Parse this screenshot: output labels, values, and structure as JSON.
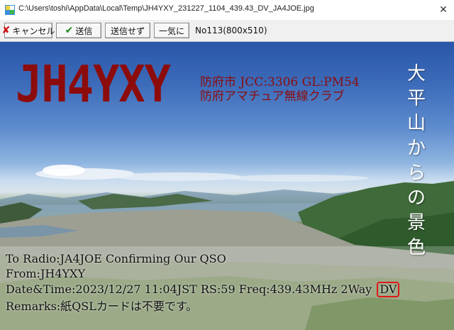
{
  "window": {
    "title": "C:\\Users\\toshi\\AppData\\Local\\Temp\\JH4YXY_231227_1104_439.43_DV_JA4JOE.jpg",
    "close_glyph": "✕"
  },
  "toolbar": {
    "cancel_label": "キャンセル",
    "send_label": "送信",
    "no_send_label": "送信せず",
    "all_at_once_label": "一気に",
    "counter_text": "No113(800x510)"
  },
  "card": {
    "callsign": "JH4YXY",
    "info_line1": "防府市 JCC:3306 GL:PM54",
    "info_line2": "防府アマチュア無線クラブ",
    "vertical_text": [
      "大",
      "平",
      "山",
      "か",
      "ら",
      "の",
      "景",
      "色"
    ],
    "to_radio": "To Radio:JA4JOE  Confirming Our QSO",
    "from": "From:JH4YXY",
    "datetime_line": "Date&Time:2023/12/27 11:04JST RS:59 Freq:439.43MHz 2Way",
    "mode": "DV",
    "remarks": "Remarks:紙QSLカードは不要です。"
  },
  "colors": {
    "callsign_red": "#8c0c0c",
    "highlight_red": "#e01818",
    "send_green": "#1c8a1c",
    "cancel_red": "#d01010"
  },
  "icons": {
    "app": "app-icon",
    "cancel": "x-icon",
    "send": "checkmark-icon",
    "close": "close-icon"
  }
}
